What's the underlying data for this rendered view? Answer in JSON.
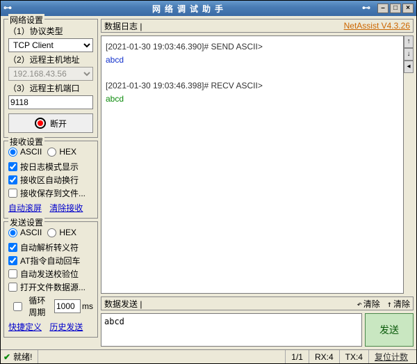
{
  "window": {
    "title": "网络调试助手"
  },
  "net": {
    "title": "网络设置",
    "proto_label": "（1）协议类型",
    "proto_value": "TCP Client",
    "host_label": "（2）远程主机地址",
    "host_value": "192.168.43.56",
    "port_label": "（3）远程主机端口",
    "port_value": "9118",
    "disconnect": "断开"
  },
  "recv": {
    "title": "接收设置",
    "ascii": "ASCII",
    "hex": "HEX",
    "opt1": "按日志模式显示",
    "opt2": "接收区自动换行",
    "opt3": "接收保存到文件...",
    "link1": "自动滚屏",
    "link2": "清除接收"
  },
  "send": {
    "title": "发送设置",
    "ascii": "ASCII",
    "hex": "HEX",
    "opt1": "自动解析转义符",
    "opt2": "AT指令自动回车",
    "opt3": "自动发送校验位",
    "opt4": "打开文件数据源...",
    "cycle_label": "循环周期",
    "cycle_value": "1000",
    "cycle_unit": "ms",
    "link1": "快捷定义",
    "link2": "历史发送"
  },
  "log": {
    "title": "数据日志 |",
    "version": "NetAssist V4.3.26",
    "line1": "[2021-01-30 19:03:46.390]# SEND ASCII>",
    "payload1": "abcd",
    "line2": "[2021-01-30 19:03:46.398]# RECV ASCII>",
    "payload2": "abcd"
  },
  "sendbox": {
    "title": "数据发送 |",
    "clear1": "清除",
    "clear2": "清除",
    "value": "abcd",
    "button": "发送"
  },
  "status": {
    "ready": "就绪!",
    "page": "1/1",
    "rx": "RX:4",
    "tx": "TX:4",
    "reset": "复位计数"
  }
}
